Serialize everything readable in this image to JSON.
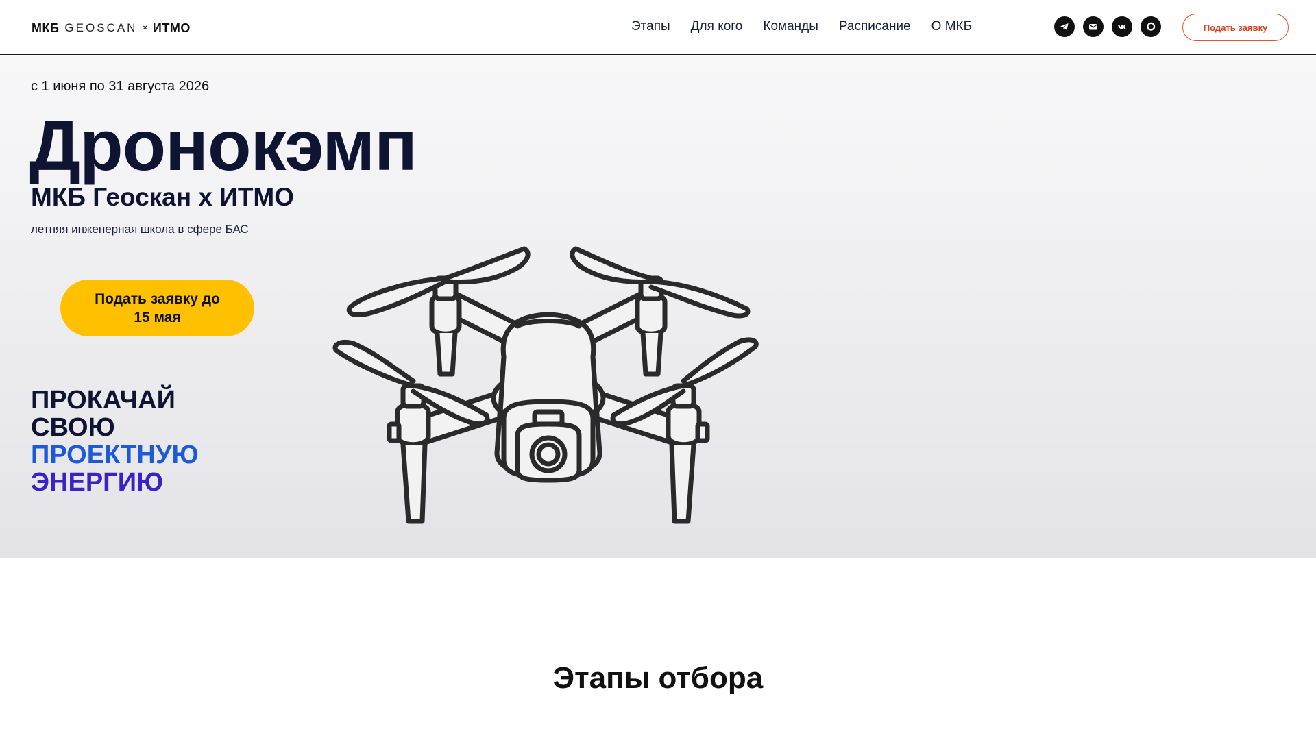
{
  "header": {
    "logo": {
      "mkb": "МКБ",
      "geoscan": "GEOSCAN",
      "x": "×",
      "itmo": "ИТМО"
    },
    "nav": [
      "Этапы",
      "Для кого",
      "Команды",
      "Расписание",
      "О МКБ"
    ],
    "socials": [
      "telegram-icon",
      "mail-icon",
      "vk-icon",
      "max-icon"
    ],
    "apply_button": "Подать заявку"
  },
  "hero": {
    "date": "с 1 июня по 31 августа 2026",
    "title": "Дронокэмп",
    "subtitle": "МКБ Геоскан x ИТМО",
    "tagline": "летняя инженерная школа в сфере БАС",
    "cta": "Подать заявку до 15 мая",
    "slogan": [
      "ПРОКАЧАЙ",
      "СВОЮ",
      "ПРОЕКТНУЮ",
      "ЭНЕРГИЮ"
    ]
  },
  "sections": {
    "stages_title": "Этапы отбора"
  },
  "colors": {
    "accent_yellow": "#ffc000",
    "header_button": "#e0401d",
    "slogan_blue": "#1e5ad6",
    "slogan_violet": "#3a22c4",
    "title_navy": "#0f1433"
  }
}
